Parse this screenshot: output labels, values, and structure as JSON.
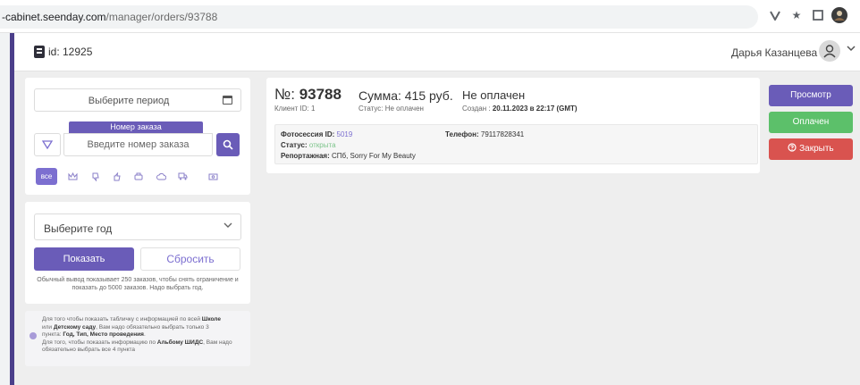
{
  "browser": {
    "url_host": "-cabinet.seenday.com",
    "url_path": "/manager/orders/93788",
    "icons": [
      "v-icon",
      "star-icon",
      "window-icon",
      "profile-icon",
      "more-icon"
    ]
  },
  "header": {
    "id_label": "id: 12925",
    "user_name": "Дарья Казанцева"
  },
  "filters": {
    "period_placeholder": "Выберите период",
    "order_tag": "Номер заказа",
    "order_placeholder": "Введите номер заказа",
    "chip_all": "все",
    "year_placeholder": "Выберите год",
    "show_label": "Показать",
    "reset_label": "Сбросить",
    "hint": "Обычный вывод показывает 250 заказов, чтобы снять ограничение и показать до 5000 заказов. Надо выбрать год."
  },
  "info": {
    "line1_a": "Для того чтобы показать табличку с информацией по всей ",
    "line1_b": "Школе",
    "line2_a": "или ",
    "line2_b": "Детскому саду",
    "line2_c": ", Вам надо обязательно выбрать только 3",
    "line3_a": "пункта: ",
    "line3_b": "Год, Тип, Место проведения",
    "line3_c": ".",
    "line4_a": "Для того, чтобы показать информацию по ",
    "line4_b": "Альбому ШИДС",
    "line4_c": ", Вам надо",
    "line5": "обязательно выбрать все 4 пункта"
  },
  "order": {
    "number_prefix": "№: ",
    "number": "93788",
    "client_id": "Клиент ID: 1",
    "sum": "Сумма: 415 руб.",
    "status_line": "Статус: Не оплачен",
    "payment_status": "Не оплачен",
    "created_label": "Создан : ",
    "created_value": "20.11.2023 в 22:17 (GMT)",
    "photosession_label": "Фотосессия ID:",
    "photosession_id": "5019",
    "status_label": "Статус:",
    "status_value": "открыта",
    "reportage_label": "Репортажная:",
    "reportage_value": "СПб, Sorry For My Beauty",
    "phone_label": "Телефон:",
    "phone_value": "79117828341"
  },
  "actions": {
    "view": "Просмотр",
    "paid": "Оплачен",
    "close": "Закрыть"
  },
  "colors": {
    "accent": "#6a5cb8",
    "success": "#5cc06a",
    "danger": "#d9534f"
  }
}
